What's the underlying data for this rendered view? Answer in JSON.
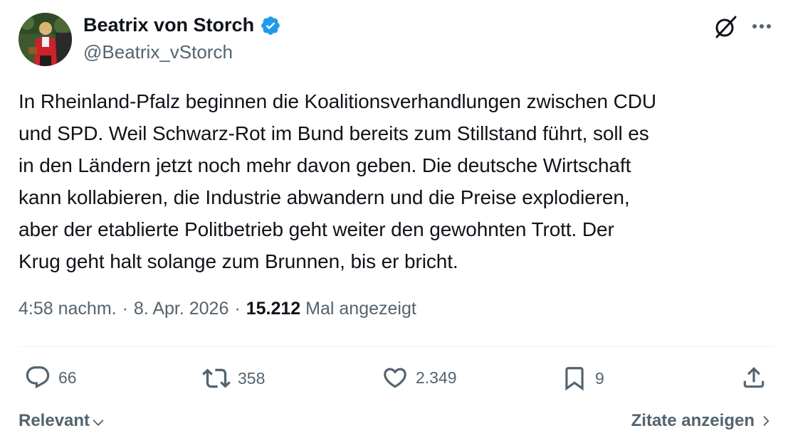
{
  "author": {
    "name": "Beatrix von Storch",
    "handle": "@Beatrix_vStorch",
    "verified": true,
    "verified_color": "#1d9bf0"
  },
  "header_icons": [
    "grok-icon",
    "more-icon"
  ],
  "tweet": {
    "text": "In Rheinland-Pfalz beginnen die Koalitionsverhandlungen zwischen CDU\nund SPD. Weil Schwarz-Rot im Bund bereits zum Stillstand führt, soll es\nin den Ländern jetzt noch mehr davon geben. Die deutsche Wirtschaft\nkann kollabieren, die Industrie abwandern und die Preise explodieren,\naber der etablierte Politbetrieb geht weiter den gewohnten Trott. Der\nKrug geht halt solange zum Brunnen, bis er bricht.",
    "time": "4:58 nachm.",
    "date": "8. Apr. 2026",
    "separator": "·",
    "views": "15.212",
    "views_label": "Mal angezeigt"
  },
  "actions": {
    "replies": "66",
    "reposts": "358",
    "likes": "2.349",
    "bookmarks": "9"
  },
  "footer": {
    "sort_label": "Relevant",
    "quotes_label": "Zitate anzeigen"
  },
  "colors": {
    "text": "#0f1419",
    "secondary": "#536471",
    "divider": "#eff3f4"
  }
}
